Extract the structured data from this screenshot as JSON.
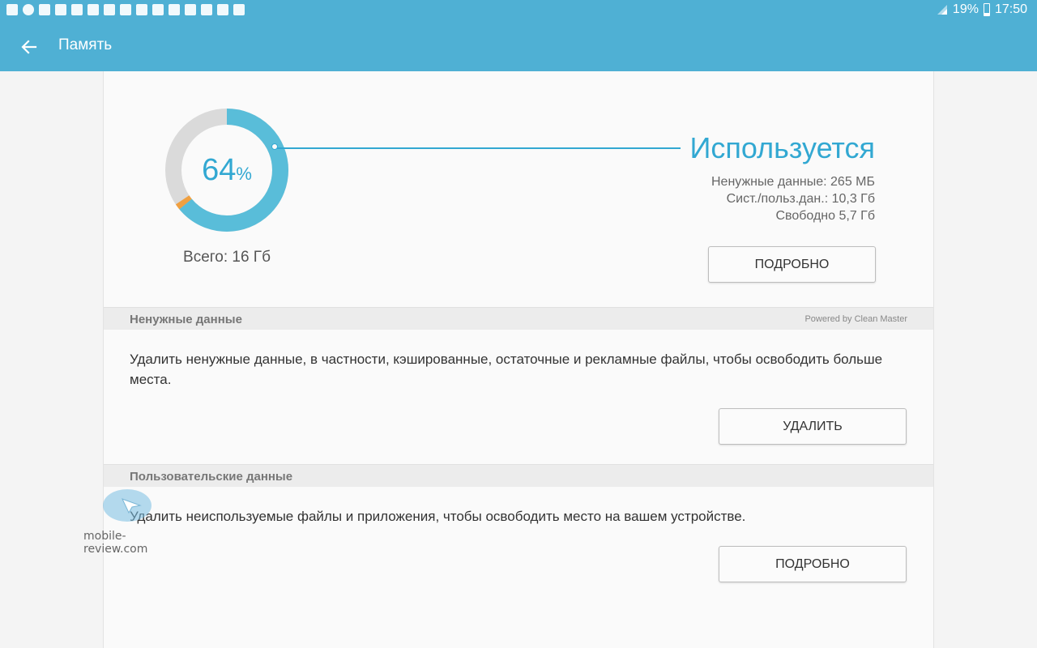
{
  "status_bar": {
    "battery": "19%",
    "time": "17:50",
    "notification_icons": [
      "no-sound-icon",
      "chat-icon",
      "gmail-icon",
      "gallery-icon",
      "drive-icon",
      "app-icon",
      "app-icon",
      "app-icon",
      "app-icon",
      "app-icon",
      "app-icon",
      "app-icon",
      "calendar-icon",
      "screenshot-icon",
      "screenshot-icon"
    ],
    "battery_level": 0.19
  },
  "header": {
    "title": "Память"
  },
  "storage": {
    "percent": "64",
    "percent_sign": "%",
    "total": "Всего: 16 Гб",
    "used_title": "Используется",
    "junk": "Ненужные данные: 265 МБ",
    "system_user": "Сист./польз.дан.: 10,3 Гб",
    "free": "Свободно 5,7 Гб",
    "details_button": "ПОДРОБНО",
    "colors": {
      "used": "#59bdd9",
      "junk": "#f0a040",
      "free": "#dadada"
    },
    "used_fraction": 0.64,
    "junk_fraction": 0.016
  },
  "junk_section": {
    "title": "Ненужные данные",
    "powered_by": "Powered by Clean Master",
    "description": "Удалить ненужные данные, в частности, кэшированные, остаточные и рекламные файлы, чтобы освободить больше места.",
    "button": "УДАЛИТЬ"
  },
  "user_section": {
    "title": "Пользовательские данные",
    "description": "Удалить неиспользуемые файлы и приложения, чтобы освободить место на вашем устройстве.",
    "button": "ПОДРОБНО"
  },
  "watermark": {
    "text": "mobile-review.com"
  }
}
